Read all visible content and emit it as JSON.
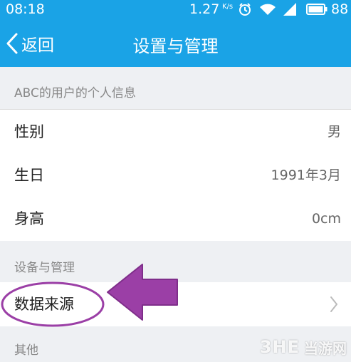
{
  "status_bar": {
    "time": "08:18",
    "net_speed": "1.27",
    "net_speed_unit": "K/s",
    "battery_percent": "88",
    "icons": [
      "alarm-icon",
      "wifi-icon",
      "signal-icon",
      "battery-icon"
    ]
  },
  "nav": {
    "back_label": "返回",
    "title": "设置与管理"
  },
  "personal_section": {
    "header": "ABC的用户的个人信息",
    "rows": [
      {
        "label": "性别",
        "value": "男"
      },
      {
        "label": "生日",
        "value": "1991年3月"
      },
      {
        "label": "身高",
        "value": "0cm"
      }
    ]
  },
  "device_section": {
    "header": "设备与管理",
    "rows": [
      {
        "label": "数据来源"
      }
    ]
  },
  "other_section": {
    "header": "其他"
  },
  "watermark": {
    "brand": "3HE",
    "text": "当游网"
  },
  "colors": {
    "header_blue": "#1aa3e6",
    "annotation_purple": "#9b3fa6",
    "page_background": "#eef0f3"
  }
}
